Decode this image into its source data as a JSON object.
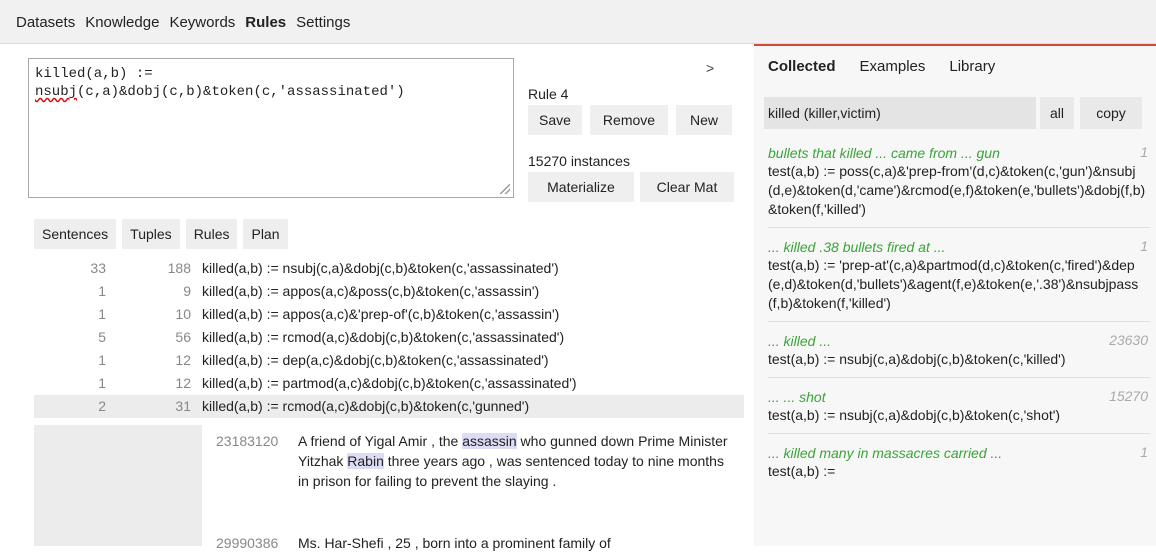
{
  "nav": {
    "items": [
      "Datasets",
      "Knowledge",
      "Keywords",
      "Rules",
      "Settings"
    ],
    "active": "Rules"
  },
  "editor": {
    "line1": "killed(a,b) :=",
    "line2_squiggle": "nsubj",
    "line2_rest": "(c,a)&dobj(c,b)&token(c,'assassinated')"
  },
  "expand_label": ">",
  "rule": {
    "label": "Rule 4",
    "save": "Save",
    "remove": "Remove",
    "new": "New",
    "instances": "15270 instances",
    "materialize": "Materialize",
    "clear_mat": "Clear Mat"
  },
  "tabs": [
    "Sentences",
    "Tuples",
    "Rules",
    "Plan"
  ],
  "rules_list": [
    {
      "c1": "33",
      "c2": "188",
      "text": "killed(a,b) := nsubj(c,a)&dobj(c,b)&token(c,'assassinated')"
    },
    {
      "c1": "1",
      "c2": "9",
      "text": "killed(a,b) := appos(a,c)&poss(c,b)&token(c,'assassin')"
    },
    {
      "c1": "1",
      "c2": "10",
      "text": "killed(a,b) := appos(a,c)&'prep-of'(c,b)&token(c,'assassin')"
    },
    {
      "c1": "5",
      "c2": "56",
      "text": "killed(a,b) := rcmod(a,c)&dobj(c,b)&token(c,'assassinated')"
    },
    {
      "c1": "1",
      "c2": "12",
      "text": "killed(a,b) := dep(a,c)&dobj(c,b)&token(c,'assassinated')"
    },
    {
      "c1": "1",
      "c2": "12",
      "text": "killed(a,b) := partmod(a,c)&dobj(c,b)&token(c,'assassinated')"
    },
    {
      "c1": "2",
      "c2": "31",
      "text": "killed(a,b) := rcmod(a,c)&dobj(c,b)&token(c,'gunned')"
    }
  ],
  "sentences": [
    {
      "id": "23183120",
      "t1": "A friend of Yigal Amir , the ",
      "h1": "assassin",
      "t2": " who gunned down Prime Minister Yitzhak ",
      "h2": "Rabin",
      "t3": " three years ago , was sentenced today to nine months in prison for failing to prevent the slaying ."
    },
    {
      "id": "29990386",
      "text": "Ms. Har-Shefi , 25 , born into a prominent family of"
    }
  ],
  "right": {
    "tabs": [
      "Collected",
      "Examples",
      "Library"
    ],
    "active_tab": "Collected",
    "query": "killed (killer,victim)",
    "all_label": "all",
    "copy_label": "copy",
    "items": [
      {
        "phrase": "bullets that killed ... came from ... gun",
        "count": "1",
        "code": "test(a,b) := poss(c,a)&'prep-from'(d,c)&token(c,'gun')&nsubj(d,e)&token(d,'came')&rcmod(e,f)&token(e,'bullets')&dobj(f,b)&token(f,'killed')"
      },
      {
        "phrase": "... killed .38 bullets fired at ...",
        "count": "1",
        "code": "test(a,b) := 'prep-at'(c,a)&partmod(d,c)&token(c,'fired')&dep(e,d)&token(d,'bullets')&agent(f,e)&token(e,'.38')&nsubjpass(f,b)&token(f,'killed')"
      },
      {
        "phrase": "... killed ...",
        "count": "23630",
        "code": "test(a,b) := nsubj(c,a)&dobj(c,b)&token(c,'killed')"
      },
      {
        "phrase": "... ... shot",
        "count": "15270",
        "code": "test(a,b) := nsubj(c,a)&dobj(c,b)&token(c,'shot')"
      },
      {
        "phrase": "... killed many in massacres carried ...",
        "count": "1",
        "code": "test(a,b) :="
      }
    ]
  }
}
